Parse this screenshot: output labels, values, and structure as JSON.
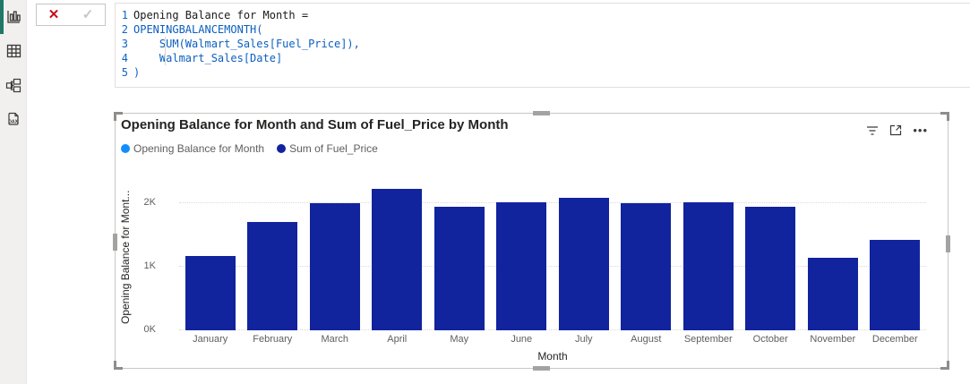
{
  "colors": {
    "active_view_indicator": "#217865",
    "icon": "#3b3a39",
    "cancel_red": "#c50f1f",
    "commit_gray": "#c8c6c4",
    "code_function_blue": "#0b5fc0",
    "bar_dark_blue": "#12239E",
    "legend_light_blue": "#118DFF",
    "text_dark": "#252423",
    "text_gray": "#605e5c"
  },
  "sidebar": {
    "icons": [
      "bar-chart-icon",
      "table-icon",
      "model-icon",
      "dax-query-icon"
    ],
    "active_index": 0
  },
  "formula_bar": {
    "cancel_glyph": "✕",
    "commit_glyph": "✓",
    "lines": [
      {
        "num": "1",
        "code": "Opening Balance for Month =",
        "style": "plain"
      },
      {
        "num": "2",
        "code": "OPENINGBALANCEMONTH(",
        "style": "func"
      },
      {
        "num": "3",
        "code": "    SUM(Walmart_Sales[Fuel_Price]),",
        "style": "func"
      },
      {
        "num": "4",
        "code": "    Walmart_Sales[Date]",
        "style": "func"
      },
      {
        "num": "5",
        "code": ")",
        "style": "func"
      }
    ]
  },
  "visual": {
    "title": "Opening Balance for Month and Sum of Fuel_Price by Month",
    "header_icons": [
      "filter-icon",
      "focus-mode-icon",
      "more-options-icon"
    ],
    "more_options_glyph": "•••",
    "legend": [
      {
        "label": "Opening Balance for Month",
        "color": "#118DFF"
      },
      {
        "label": "Sum of Fuel_Price",
        "color": "#12239E"
      }
    ]
  },
  "chart_data": {
    "type": "bar",
    "title": "Opening Balance for Month and Sum of Fuel_Price by Month",
    "categories": [
      "January",
      "February",
      "March",
      "April",
      "May",
      "June",
      "July",
      "August",
      "September",
      "October",
      "November",
      "December"
    ],
    "series": [
      {
        "name": "Opening Balance for Month",
        "color": "#118DFF",
        "values": [
          null,
          null,
          null,
          null,
          null,
          null,
          null,
          null,
          null,
          null,
          null,
          null
        ]
      },
      {
        "name": "Sum of Fuel_Price",
        "color": "#12239E",
        "values": [
          1170,
          1700,
          2000,
          2230,
          1950,
          2020,
          2080,
          2000,
          2010,
          1950,
          1140,
          1420
        ]
      }
    ],
    "xlabel": "Month",
    "ylabel": "Opening Balance for Mont...",
    "ytick_labels": [
      "0K",
      "1K",
      "2K"
    ],
    "ylim": [
      0,
      2400
    ],
    "gridlines": "dotted",
    "legend_position": "top-left"
  }
}
